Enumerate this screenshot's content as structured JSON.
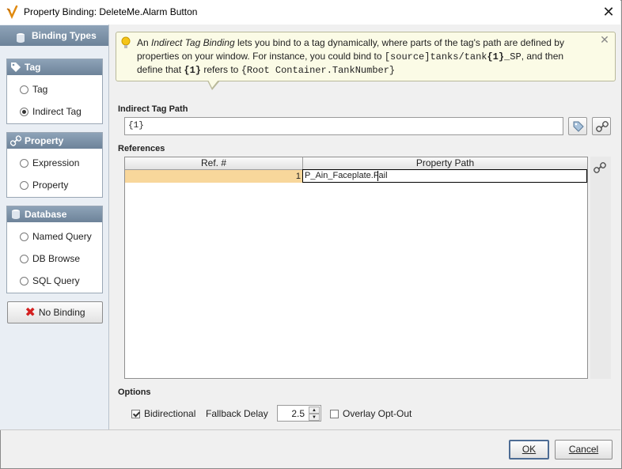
{
  "window": {
    "title": "Property Binding: DeleteMe.Alarm Button"
  },
  "sidebar": {
    "header": "Binding Types",
    "groups": [
      {
        "title": "Tag",
        "icon": "tag-icon",
        "options": [
          {
            "label": "Tag",
            "selected": false
          },
          {
            "label": "Indirect Tag",
            "selected": true
          }
        ]
      },
      {
        "title": "Property",
        "icon": "link-icon",
        "options": [
          {
            "label": "Expression",
            "selected": false
          },
          {
            "label": "Property",
            "selected": false
          }
        ]
      },
      {
        "title": "Database",
        "icon": "database-icon",
        "options": [
          {
            "label": "Named Query",
            "selected": false
          },
          {
            "label": "DB Browse",
            "selected": false
          },
          {
            "label": "SQL Query",
            "selected": false
          }
        ]
      }
    ],
    "no_binding_label": "No Binding"
  },
  "info": {
    "line1_prefix": "An ",
    "line1_em": "Indirect Tag Binding",
    "line1_rest": " lets you bind to a tag dynamically, where parts of the tag's path are defined by",
    "line2_text": "properties on your window. For instance, you could bind to ",
    "line2_code_a": "[source]tanks/tank",
    "line2_code_b": "{1}",
    "line2_code_c": "_SP",
    "line2_end": ", and then",
    "line3_text": "define that ",
    "line3_code_a": "{1}",
    "line3_mid": " refers to ",
    "line3_code_b": "{Root Container.TankNumber}"
  },
  "indirect_tag_path": {
    "label": "Indirect Tag Path",
    "value": "{1}"
  },
  "references": {
    "label": "References",
    "columns": [
      "Ref. #",
      "Property Path"
    ],
    "rows": [
      {
        "ref": "1",
        "path": "P_Ain_Faceplate.Fail"
      }
    ]
  },
  "options": {
    "label": "Options",
    "bidirectional_label": "Bidirectional",
    "bidirectional_checked": true,
    "fallback_delay_label": "Fallback Delay",
    "fallback_delay_value": "2.5",
    "overlay_optout_label": "Overlay Opt-Out",
    "overlay_optout_checked": false
  },
  "buttons": {
    "ok": "OK",
    "cancel": "Cancel"
  },
  "colors": {
    "accent_header": "#7d93a9",
    "selected_cell": "#f8d79b",
    "info_bg": "#fbfbe6",
    "no_binding_x": "#d42020"
  }
}
